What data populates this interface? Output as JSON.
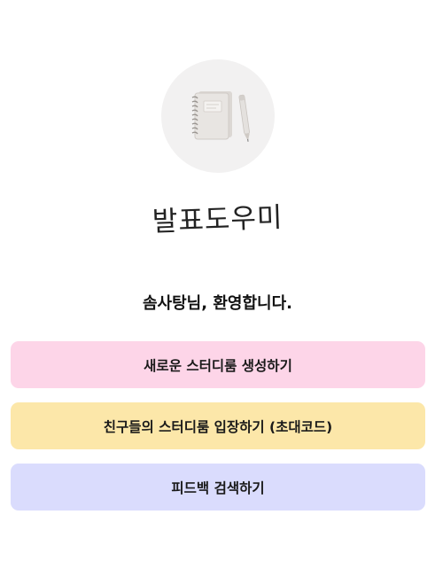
{
  "logo": {
    "icon": "notebook-pen-icon"
  },
  "app": {
    "title": "발표도우미"
  },
  "welcome": {
    "message": "솜사탕님, 환영합니다."
  },
  "actions": [
    {
      "label": "새로운 스터디룸 생성하기",
      "color": "#fdd5e8"
    },
    {
      "label": "친구들의 스터디룸 입장하기 (초대코드)",
      "color": "#fce7a9"
    },
    {
      "label": "피드백 검색하기",
      "color": "#dadcfd"
    }
  ]
}
